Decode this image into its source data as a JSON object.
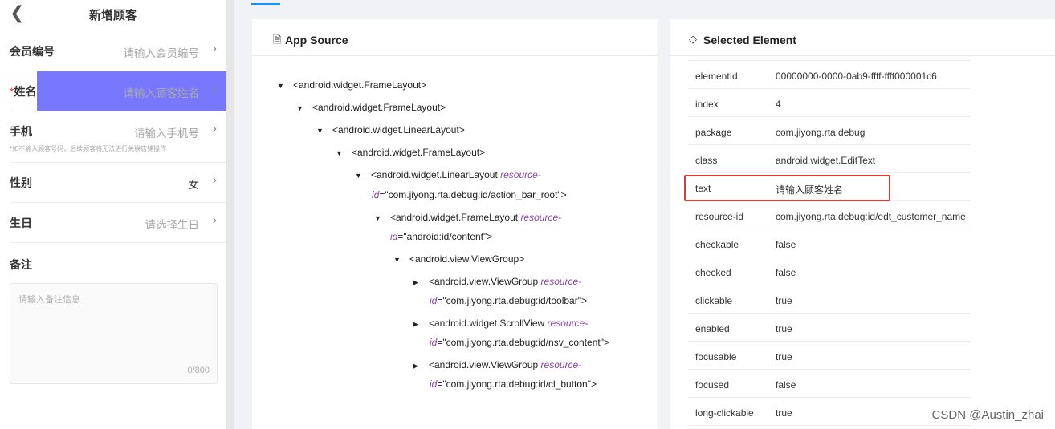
{
  "phone": {
    "title": "新增顾客",
    "rows": [
      {
        "label": "会员编号",
        "value": "请输入会员编号",
        "required": false,
        "filled": false
      },
      {
        "label": "姓名",
        "value": "请输入顾客姓名",
        "required": true,
        "filled": false
      },
      {
        "label": "手机",
        "value": "请输入手机号",
        "required": false,
        "filled": false
      },
      {
        "label": "性别",
        "value": "女",
        "required": false,
        "filled": true
      },
      {
        "label": "生日",
        "value": "请选择生日",
        "required": false,
        "filled": false
      }
    ],
    "required_mark": "*",
    "phone_hint": "*如不输入顾客号码，后续顾客将无法进行关联店铺操作",
    "remark_label": "备注",
    "remark_placeholder": "请输入备注信息",
    "remark_count": "0/800",
    "highlight_color": "#6060ff"
  },
  "app_source": {
    "title": "App Source",
    "nodes": [
      {
        "tag": "<android.widget.FrameLayout>",
        "expanded": true
      },
      {
        "tag": "<android.widget.FrameLayout>",
        "expanded": true
      },
      {
        "tag": "<android.widget.LinearLayout>",
        "expanded": true
      },
      {
        "tag": "<android.widget.FrameLayout>",
        "expanded": true
      },
      {
        "tag": "<android.widget.LinearLayout",
        "attr": "resource-",
        "cont_attr": "id",
        "cont_val": "\"com.jiyong.rta.debug:id/action_bar_root\">",
        "expanded": true
      },
      {
        "tag": "<android.widget.FrameLayout",
        "attr": "resource-",
        "cont_attr": "id",
        "cont_val": "\"android:id/content\">",
        "expanded": true
      },
      {
        "tag": "<android.view.ViewGroup>",
        "expanded": true
      },
      {
        "tag": "<android.view.ViewGroup",
        "attr": "resource-",
        "cont_attr": "id",
        "cont_val": "\"com.jiyong.rta.debug:id/toolbar\">",
        "expanded": false
      },
      {
        "tag": "<android.widget.ScrollView",
        "attr": "resource-",
        "cont_attr": "id",
        "cont_val": "\"com.jiyong.rta.debug:id/nsv_content\">",
        "expanded": false
      },
      {
        "tag": "<android.view.ViewGroup",
        "attr": "resource-",
        "cont_attr": "id",
        "cont_val": "\"com.jiyong.rta.debug:id/cl_button\">",
        "expanded": false
      }
    ]
  },
  "selected_element": {
    "title": "Selected Element",
    "attributes": [
      {
        "key": "elementId",
        "value": "00000000-0000-0ab9-ffff-ffff000001c6"
      },
      {
        "key": "index",
        "value": "4"
      },
      {
        "key": "package",
        "value": "com.jiyong.rta.debug"
      },
      {
        "key": "class",
        "value": "android.widget.EditText"
      },
      {
        "key": "text",
        "value": "请输入顾客姓名"
      },
      {
        "key": "resource-id",
        "value": "com.jiyong.rta.debug:id/edt_customer_name"
      },
      {
        "key": "checkable",
        "value": "false"
      },
      {
        "key": "checked",
        "value": "false"
      },
      {
        "key": "clickable",
        "value": "true"
      },
      {
        "key": "enabled",
        "value": "true"
      },
      {
        "key": "focusable",
        "value": "true"
      },
      {
        "key": "focused",
        "value": "false"
      },
      {
        "key": "long-clickable",
        "value": "true"
      }
    ],
    "highlight_color": "#e53935"
  },
  "watermark": "CSDN @Austin_zhai"
}
